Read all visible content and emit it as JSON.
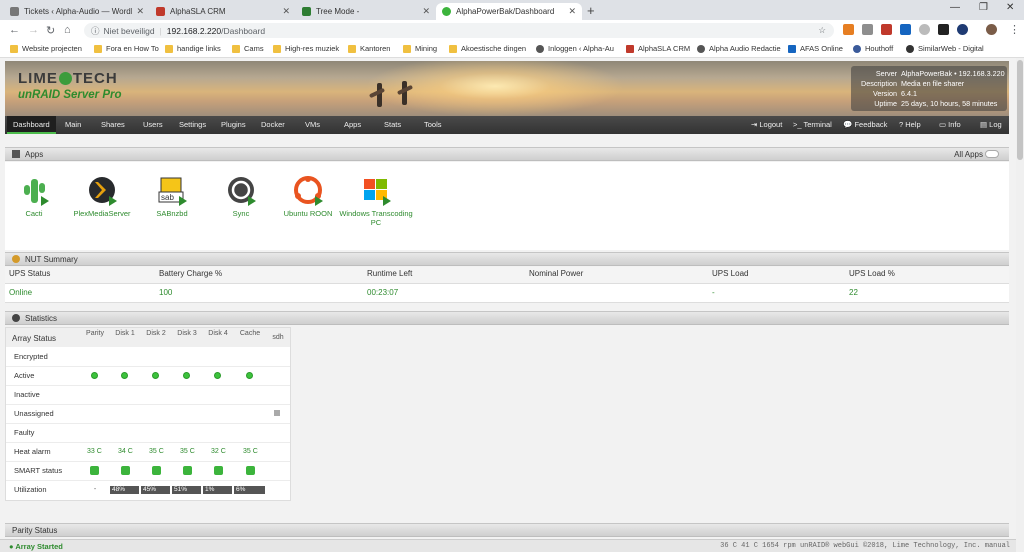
{
  "tabs": [
    {
      "title": "Tickets ‹ Alpha-Audio — WordPr",
      "color": "#777"
    },
    {
      "title": "AlphaSLA CRM",
      "color": "#c0392b"
    },
    {
      "title": "Tree Mode -",
      "color": "#2e7d32"
    },
    {
      "title": "AlphaPowerBak/Dashboard",
      "color": "#3cb43c"
    }
  ],
  "address": {
    "security": "Niet beveiligd",
    "domain": "192.168.2.220",
    "path": "/Dashboard"
  },
  "bookmarks": [
    "Website projecten",
    "Fora en How To",
    "handige links",
    "Cams",
    "High-res muziek",
    "Kantoren",
    "Mining",
    "Akoestische dingen",
    "Inloggen ‹ Alpha-Au",
    "AlphaSLA CRM",
    "Alpha Audio Redactie",
    "AFAS Online",
    "Houthoff",
    "SimilarWeb - Digital"
  ],
  "banner": {
    "logo_top": "LIME",
    "logo_top2": "TECH",
    "logo_bottom": "unRAID Server Pro"
  },
  "server_info": [
    {
      "key": "Server",
      "value": "AlphaPowerBak • 192.168.3.220"
    },
    {
      "key": "Description",
      "value": "Media en file sharer"
    },
    {
      "key": "Version",
      "value": "6.4.1"
    },
    {
      "key": "Uptime",
      "value": "25 days, 10 hours, 58 minutes"
    }
  ],
  "menu_left": [
    "Dashboard",
    "Main",
    "Shares",
    "Users",
    "Settings",
    "Plugins",
    "Docker",
    "VMs",
    "Apps",
    "Stats",
    "Tools"
  ],
  "menu_right": [
    "Logout",
    "Terminal",
    "Feedback",
    "Help",
    "Info",
    "Log"
  ],
  "apps_section": {
    "title": "Apps",
    "toggle_label": "All Apps"
  },
  "apps": [
    "Cacti",
    "PlexMediaServer",
    "SABnzbd",
    "Sync",
    "Ubuntu ROON",
    "Windows Transcoding PC"
  ],
  "nut": {
    "title": "NUT Summary",
    "headers": [
      "UPS Status",
      "Battery Charge %",
      "Runtime Left",
      "Nominal Power",
      "UPS Load",
      "UPS Load %"
    ],
    "values": [
      "Online",
      "100",
      "00:23:07",
      "",
      "-",
      "22"
    ]
  },
  "stats": {
    "title": "Statistics",
    "columns": [
      "Array Status",
      "Parity",
      "Disk 1",
      "Disk 2",
      "Disk 3",
      "Disk 4",
      "Cache",
      "sdh"
    ],
    "rows": [
      "Encrypted",
      "Active",
      "Inactive",
      "Unassigned",
      "Faulty",
      "Heat alarm",
      "SMART status",
      "Utilization"
    ],
    "temps": [
      "33 C",
      "34 C",
      "35 C",
      "35 C",
      "32 C",
      "35 C"
    ],
    "utilization": [
      "-",
      "48%",
      "45%",
      "51%",
      "1%",
      "6%"
    ]
  },
  "parity": {
    "title": "Parity Status"
  },
  "status": {
    "left": "Array Started",
    "right": "36 C   41 C   1654 rpm   unRAID® webGui ©2018, Lime Technology, Inc.   manual"
  }
}
